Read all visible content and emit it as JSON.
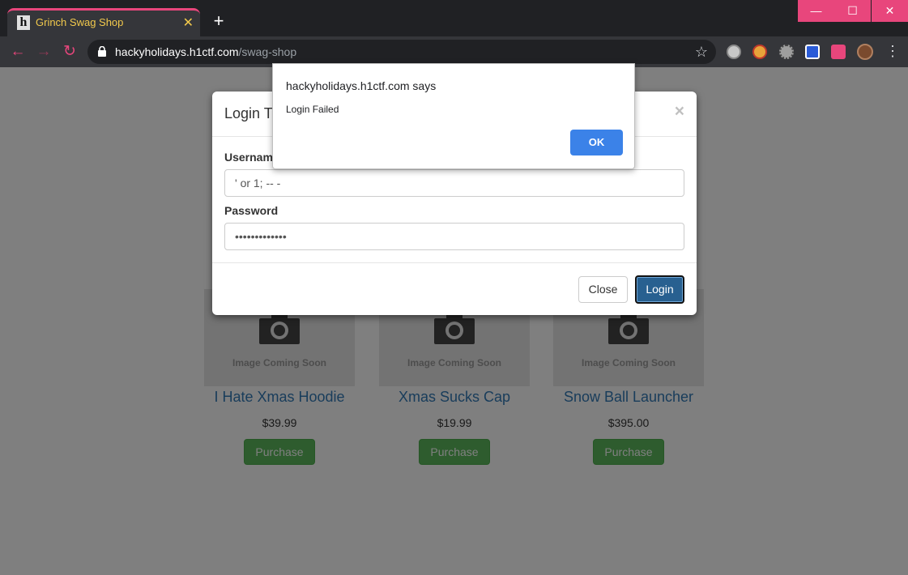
{
  "browser": {
    "tab_title": "Grinch Swag Shop",
    "tab_favicon": "h",
    "tab_close": "✕",
    "new_tab": "+",
    "url_host": "hackyholidays.h1ctf.com",
    "url_path": "/swag-shop",
    "window_controls": {
      "minimize": "—",
      "maximize": "☐",
      "close": "✕"
    },
    "icons": [
      "back-arrow-icon",
      "forward-arrow-icon",
      "reload-icon",
      "lock-icon",
      "star-icon",
      "puzzle-icon",
      "menu-icon"
    ],
    "accent_color": "#e8467c"
  },
  "products": [
    {
      "image_text": "Image Coming Soon",
      "name": "I Hate Xmas Hoodie",
      "price": "$39.99",
      "button": "Purchase"
    },
    {
      "image_text": "Image Coming Soon",
      "name": "Xmas Sucks Cap",
      "price": "$19.99",
      "button": "Purchase"
    },
    {
      "image_text": "Image Coming Soon",
      "name": "Snow Ball Launcher",
      "price": "$395.00",
      "button": "Purchase"
    }
  ],
  "modal": {
    "title": "Login T",
    "close_x": "×",
    "username_label": "Usernam",
    "username_value": "' or 1; -- -",
    "password_label": "Password",
    "password_value": "•••••••••••••",
    "close_button": "Close",
    "login_button": "Login"
  },
  "alert": {
    "origin": "hackyholidays.h1ctf.com says",
    "message": "Login Failed",
    "ok_button": "OK"
  }
}
